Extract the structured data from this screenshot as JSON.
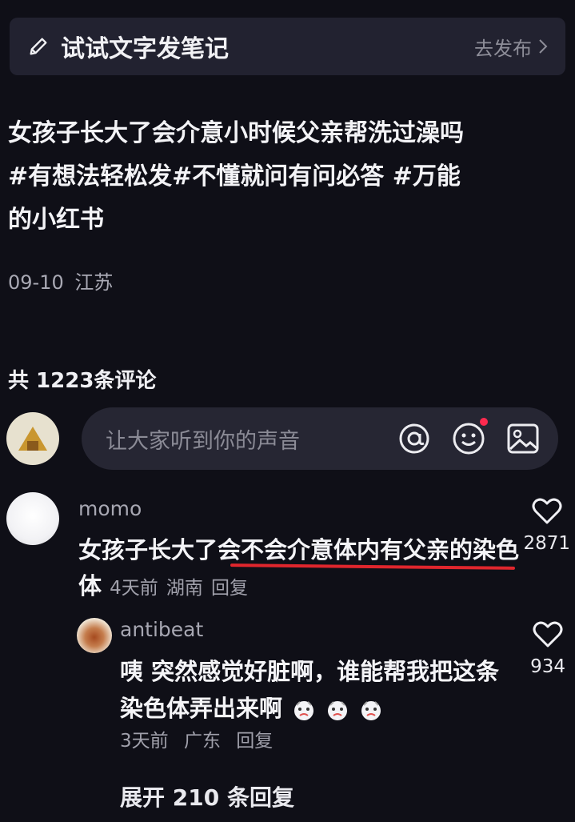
{
  "topbar": {
    "title": "试试文字发笔记",
    "publish_label": "去发布",
    "icons": {
      "pen": "pen-icon",
      "chevron": "chevron-right-icon"
    }
  },
  "post": {
    "text": "女孩子长大了会介意小时候父亲帮洗过澡吗\n#有想法轻松发#不懂就问有问必答 #万能\n的小红书",
    "date": "09-10",
    "location": "江苏"
  },
  "comments_header": {
    "count_label": "共 1223条评论"
  },
  "composer": {
    "placeholder": "让大家听到你的声音",
    "icons": [
      "at-icon",
      "emoji-icon",
      "image-icon"
    ],
    "notification_dot_color": "#ff2a4f"
  },
  "comments": [
    {
      "author": "momo",
      "text": "女孩子长大了会不会介意体内有父亲的染色体",
      "time": "4天前",
      "location": "湖南",
      "reply_label": "回复",
      "likes": "2871",
      "highlight_color": "#e0262d",
      "replies": [
        {
          "author": "antibeat",
          "text": "咦 突然感觉好脏啊，谁能帮我把这条染色体弄出来啊",
          "time": "3天前",
          "location": "广东",
          "reply_label": "回复",
          "likes": "934"
        }
      ],
      "expand_label": "展开 210 条回复"
    }
  ],
  "colors": {
    "background": "#0f0f17",
    "panel": "#222230",
    "accent_red": "#e0262d"
  }
}
